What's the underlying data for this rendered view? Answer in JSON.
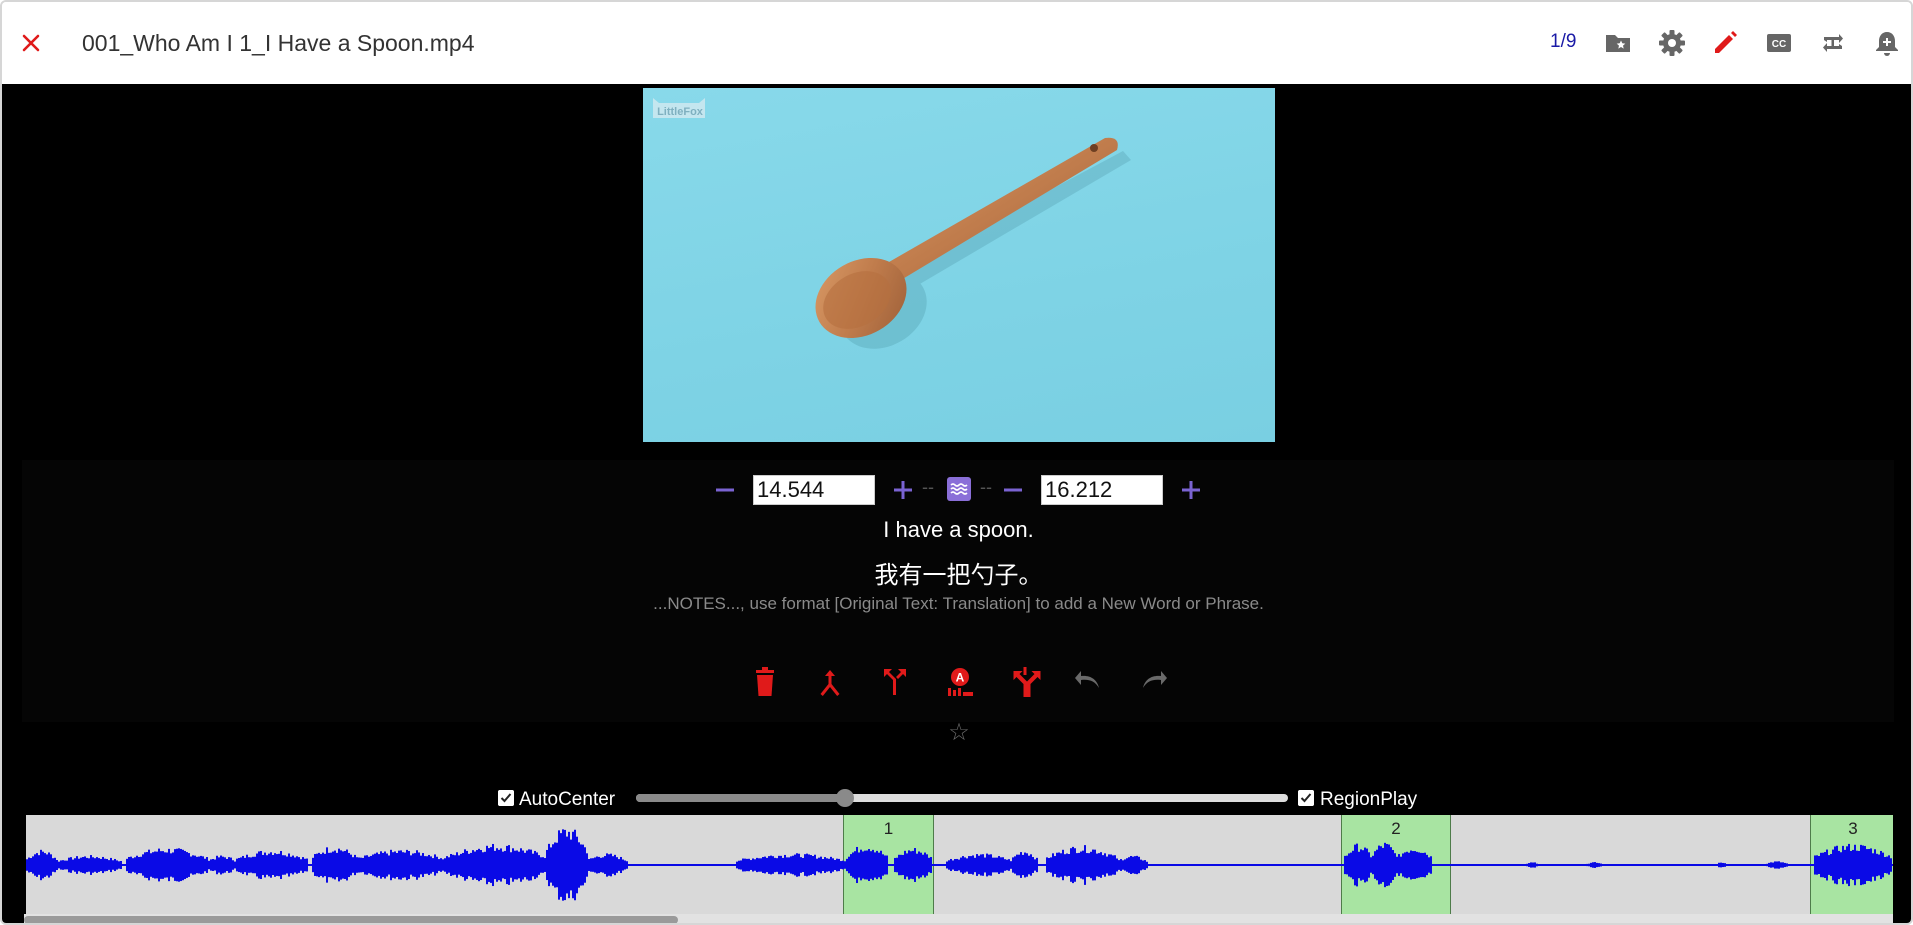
{
  "window": {
    "title": "001_Who Am I 1_I Have a Spoon.mp4",
    "page_count": "1/9"
  },
  "toolbar": {
    "icons": [
      "favorite-folder-icon",
      "settings-icon",
      "edit-pencil-icon",
      "closed-caption-icon",
      "repeat-icon",
      "notification-add-icon"
    ]
  },
  "player": {
    "logo_text": "LittleFox",
    "start_time": "14.544",
    "end_time": "16.212",
    "subtitle_en": "I have a spoon.",
    "subtitle_zh": "我有一把勺子。",
    "notes_placeholder": "...NOTES..., use format [Original Text: Translation] to add a New Word or Phrase."
  },
  "actions": [
    "delete-icon",
    "merge-icon",
    "split-icon",
    "auto-segment-icon",
    "fork-icon",
    "undo-icon",
    "redo-icon"
  ],
  "favorite_star": "☆",
  "options": {
    "autocenter_label": "AutoCenter",
    "autocenter_checked": true,
    "regionplay_label": "RegionPlay",
    "regionplay_checked": true,
    "zoom_fraction": 0.32
  },
  "regions": [
    {
      "label": "1",
      "start": 14.544,
      "end": 16.212
    },
    {
      "label": "2"
    },
    {
      "label": "3"
    }
  ],
  "colors": {
    "accent_red": "#e01a1a",
    "accent_purple": "#7a63d2",
    "waveform": "#0a0ae6",
    "region_fill": "#a8e4a2"
  },
  "scroll_fraction": 0.35
}
